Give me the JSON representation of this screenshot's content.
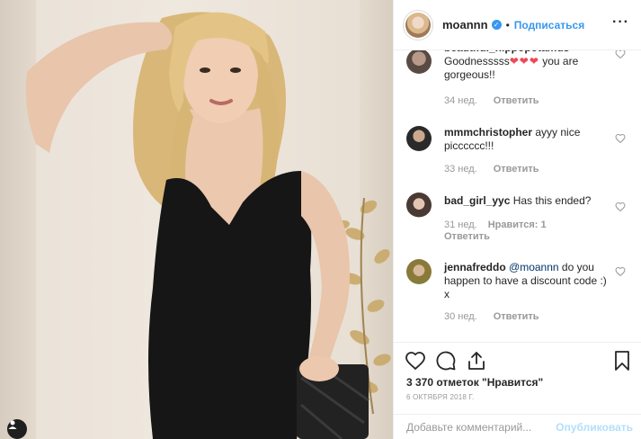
{
  "header": {
    "username": "moannn",
    "follow_label": "Подписаться",
    "dot": "•",
    "more_icon": "ellipsis-icon"
  },
  "comments": [
    {
      "username": "beautiful_hippopotamus",
      "text": "Goodnesssss",
      "emoji": "❤❤❤",
      "text_after": "you are gorgeous!!",
      "time": "34 нед.",
      "reply": "Ответить"
    },
    {
      "username": "mmmchristopher",
      "text": "ayyy nice picccccc!!!",
      "time": "33 нед.",
      "reply": "Ответить"
    },
    {
      "username": "bad_girl_yyc",
      "text": "Has this ended?",
      "time": "31 нед.",
      "likes": "Нравится: 1",
      "reply": "Ответить"
    },
    {
      "username": "jennafreddo",
      "mention": "@moannn",
      "text": "do you happen to have a discount code :) x",
      "time": "30 нед.",
      "reply": "Ответить"
    }
  ],
  "post": {
    "likes_count": "3 370 отметок \"Нравится\"",
    "date": "6 ОКТЯБРЯ 2018 Г."
  },
  "comment_box": {
    "placeholder": "Добавьте комментарий...",
    "post_label": "Опубликовать"
  },
  "colors": {
    "accent": "#3897f0",
    "heart_red": "#ed4956",
    "post_disabled": "#b2dffc"
  }
}
